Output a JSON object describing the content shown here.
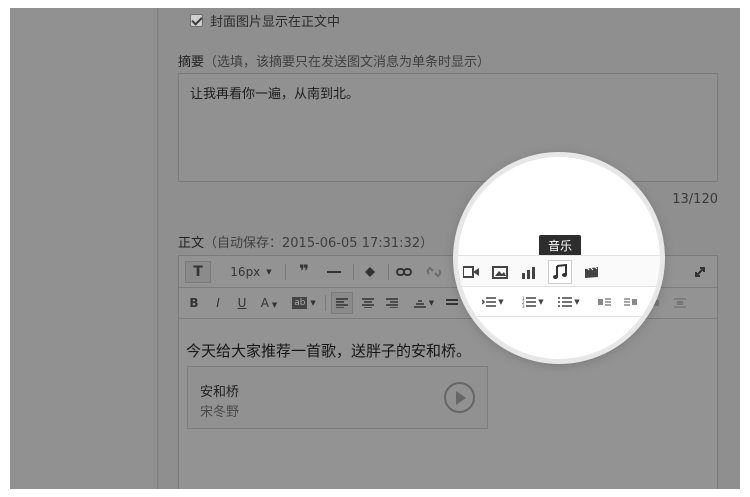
{
  "cover": {
    "checked": true,
    "label": "封面图片显示在正文中"
  },
  "abstract": {
    "title": "摘要",
    "hint": "（选填，该摘要只在发送图文消息为单条时显示）",
    "value": "让我再看你一遍，从南到北。",
    "counter": "13/120"
  },
  "body": {
    "title": "正文",
    "autosave": "（自动保存：2015-06-05 17:31:32）",
    "font_size": "16px",
    "content": "今天给大家推荐一首歌，送胖子的安和桥。"
  },
  "music_card": {
    "title": "安和桥",
    "artist": "宋冬野"
  },
  "tooltip": {
    "label": "音乐"
  },
  "icons": [
    "text-style-icon",
    "font-size-dropdown",
    "quote-icon",
    "horizontal-rule-icon",
    "format-brush-icon",
    "link-icon",
    "unlink-icon",
    "video-icon",
    "image-icon",
    "chart-icon",
    "music-icon",
    "album-icon",
    "fullscreen-icon"
  ]
}
